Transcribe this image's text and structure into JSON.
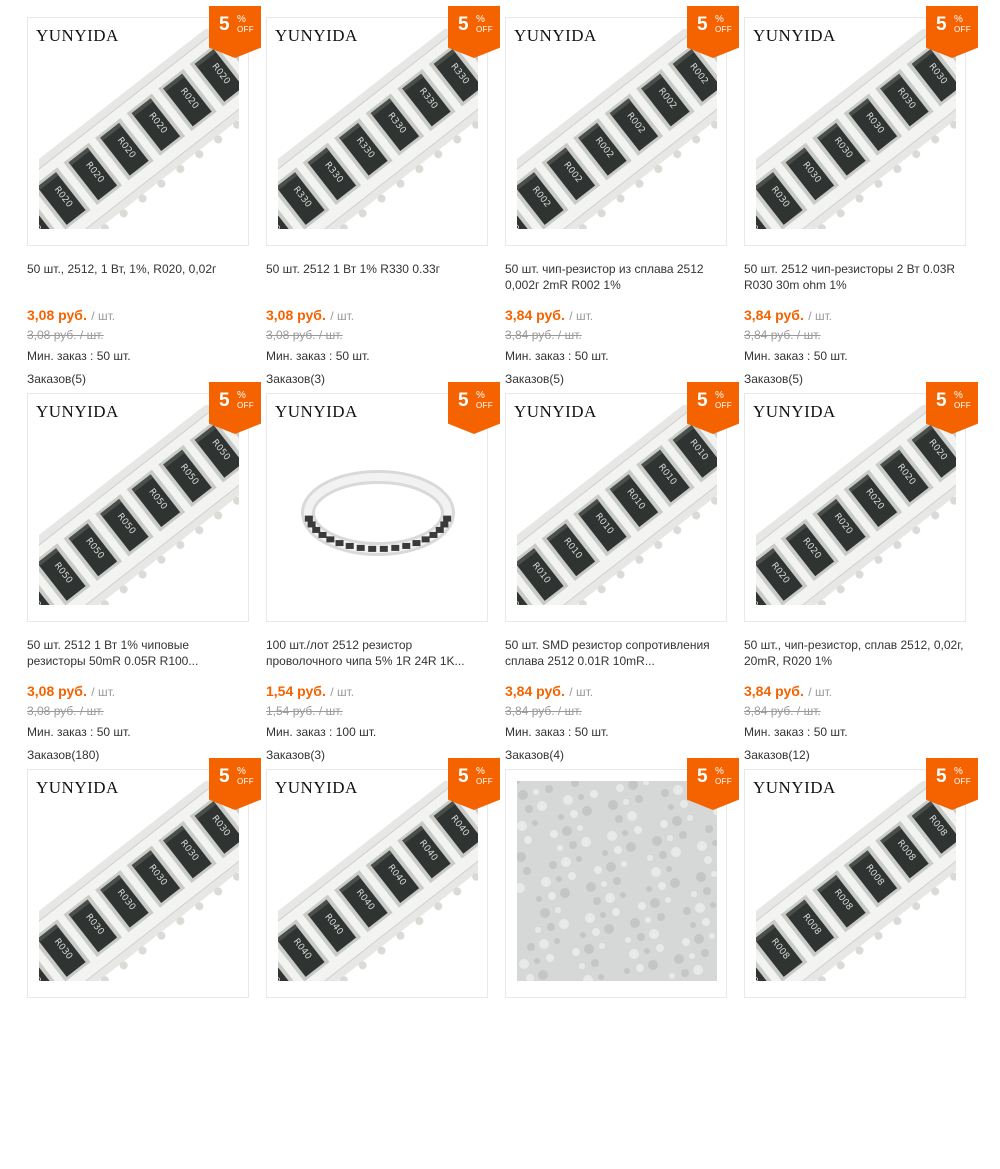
{
  "colors": {
    "accent": "#f46300",
    "text": "#333333",
    "muted": "#999999",
    "border": "#e8e8e8"
  },
  "products": [
    {
      "brand": "YUNYIDA",
      "badge": {
        "value": "5",
        "percent": "%",
        "off": "OFF"
      },
      "title": "50 шт., 2512, 1 Вт, 1%, R020, 0,02г",
      "price": "3,08 руб.",
      "unit": "/ шт.",
      "old_price": "3,08 руб. / шт.",
      "min_order": "Мин. заказ : 50 шт.",
      "orders": "Заказов(5)",
      "chip_label": "R020",
      "photo": "chip-resistor-tape-icon"
    },
    {
      "brand": "YUNYIDA",
      "badge": {
        "value": "5",
        "percent": "%",
        "off": "OFF"
      },
      "title": "50 шт. 2512 1 Вт 1% R330 0.33г",
      "price": "3,08 руб.",
      "unit": "/ шт.",
      "old_price": "3,08 руб. / шт.",
      "min_order": "Мин. заказ : 50 шт.",
      "orders": "Заказов(3)",
      "chip_label": "R330",
      "photo": "chip-resistor-tape-icon"
    },
    {
      "brand": "YUNYIDA",
      "badge": {
        "value": "5",
        "percent": "%",
        "off": "OFF"
      },
      "title": "50 шт. чип-резистор из сплава 2512 0,002г 2mR R002 1%",
      "price": "3,84 руб.",
      "unit": "/ шт.",
      "old_price": "3,84 руб. / шт.",
      "min_order": "Мин. заказ : 50 шт.",
      "orders": "Заказов(5)",
      "chip_label": "R002",
      "photo": "chip-resistor-tape-icon"
    },
    {
      "brand": "YUNYIDA",
      "badge": {
        "value": "5",
        "percent": "%",
        "off": "OFF"
      },
      "title": "50 шт. 2512 чип-резисторы 2 Вт 0.03R R030 30m ohm 1%",
      "price": "3,84 руб.",
      "unit": "/ шт.",
      "old_price": "3,84 руб. / шт.",
      "min_order": "Мин. заказ : 50 шт.",
      "orders": "Заказов(5)",
      "chip_label": "R030",
      "photo": "chip-resistor-tape-icon"
    },
    {
      "brand": "YUNYIDA",
      "badge": {
        "value": "5",
        "percent": "%",
        "off": "OFF"
      },
      "title": "50 шт. 2512 1 Вт 1% чиповые резисторы 50mR 0.05R R100...",
      "price": "3,08 руб.",
      "unit": "/ шт.",
      "old_price": "3,08 руб. / шт.",
      "min_order": "Мин. заказ : 50 шт.",
      "orders": "Заказов(180)",
      "chip_label": "R050",
      "photo": "chip-resistor-tape-icon"
    },
    {
      "brand": "YUNYIDA",
      "badge": {
        "value": "5",
        "percent": "%",
        "off": "OFF"
      },
      "title": "100 шт./лот 2512 резистор проволочного чипа 5% 1R 24R 1K...",
      "price": "1,54 руб.",
      "unit": "/ шт.",
      "old_price": "1,54 руб. / шт.",
      "min_order": "Мин. заказ : 100 шт.",
      "orders": "Заказов(3)",
      "chip_label": "",
      "photo": "resistor-reel-icon"
    },
    {
      "brand": "YUNYIDA",
      "badge": {
        "value": "5",
        "percent": "%",
        "off": "OFF"
      },
      "title": "50 шт. SMD резистор сопротивления сплава 2512 0.01R 10mR...",
      "price": "3,84 руб.",
      "unit": "/ шт.",
      "old_price": "3,84 руб. / шт.",
      "min_order": "Мин. заказ : 50 шт.",
      "orders": "Заказов(4)",
      "chip_label": "R010",
      "photo": "chip-resistor-tape-icon"
    },
    {
      "brand": "YUNYIDA",
      "badge": {
        "value": "5",
        "percent": "%",
        "off": "OFF"
      },
      "title": "50 шт., чип-резистор, сплав 2512, 0,02г, 20mR, R020 1%",
      "price": "3,84 руб.",
      "unit": "/ шт.",
      "old_price": "3,84 руб. / шт.",
      "min_order": "Мин. заказ : 50 шт.",
      "orders": "Заказов(12)",
      "chip_label": "R020",
      "photo": "chip-resistor-tape-icon"
    },
    {
      "brand": "YUNYIDA",
      "badge": {
        "value": "5",
        "percent": "%",
        "off": "OFF"
      },
      "title": "",
      "price": "",
      "unit": "",
      "old_price": "",
      "min_order": "",
      "orders": "",
      "chip_label": "R030",
      "photo": "chip-resistor-tape-icon"
    },
    {
      "brand": "YUNYIDA",
      "badge": {
        "value": "5",
        "percent": "%",
        "off": "OFF"
      },
      "title": "",
      "price": "",
      "unit": "",
      "old_price": "",
      "min_order": "",
      "orders": "",
      "chip_label": "R040",
      "photo": "chip-resistor-tape-icon"
    },
    {
      "brand": "",
      "badge": {
        "value": "5",
        "percent": "%",
        "off": "OFF"
      },
      "title": "",
      "price": "",
      "unit": "",
      "old_price": "",
      "min_order": "",
      "orders": "",
      "chip_label": "",
      "photo": "texture-photo-icon"
    },
    {
      "brand": "YUNYIDA",
      "badge": {
        "value": "5",
        "percent": "%",
        "off": "OFF"
      },
      "title": "",
      "price": "",
      "unit": "",
      "old_price": "",
      "min_order": "",
      "orders": "",
      "chip_label": "R008",
      "photo": "chip-resistor-tape-icon"
    }
  ]
}
